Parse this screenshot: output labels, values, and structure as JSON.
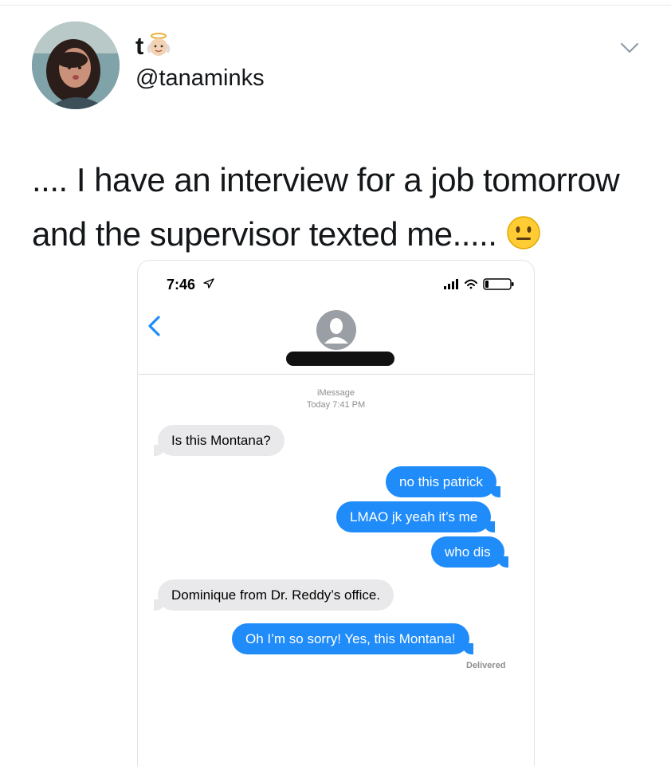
{
  "tweet": {
    "display_name": "t",
    "display_name_emoji": "baby-angel-emoji",
    "handle": "@tanaminks",
    "text": ".... I have an interview for a job tomorrow and the supervisor texted me.....",
    "text_emoji": "neutral-face-emoji"
  },
  "phone": {
    "status_time": "7:46",
    "service": "iMessage",
    "timestamp": "Today 7:41 PM",
    "messages": [
      {
        "from": "them",
        "text": "Is this Montana?"
      },
      {
        "from": "me",
        "text": "no this patrick"
      },
      {
        "from": "me",
        "text": "LMAO jk yeah it’s me"
      },
      {
        "from": "me",
        "text": "who dis"
      },
      {
        "from": "them",
        "text": "Dominique from Dr. Reddy’s office."
      },
      {
        "from": "me",
        "text": "Oh I’m so sorry! Yes, this Montana!"
      }
    ],
    "delivered_label": "Delivered"
  },
  "colors": {
    "outgoing_bubble": "#1f8cfa",
    "incoming_bubble": "#e9e9eb",
    "ios_blue": "#1f8cfa"
  }
}
